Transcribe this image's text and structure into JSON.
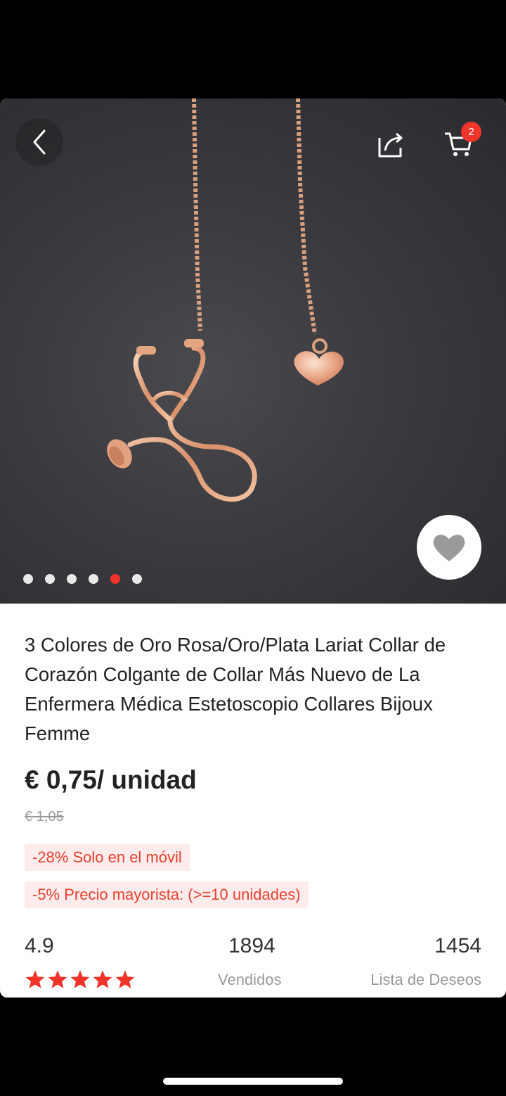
{
  "header": {
    "cart_badge_count": "2",
    "back_icon": "chevron-left-icon",
    "share_icon": "share-icon",
    "cart_icon": "cart-icon",
    "wishlist_icon": "heart-icon"
  },
  "gallery": {
    "image_count": 6,
    "active_index": 4,
    "accent_color": "#f0342a"
  },
  "product": {
    "title": "3 Colores de Oro Rosa/Oro/Plata Lariat Collar de Corazón Colgante de Collar Más Nuevo de La Enfermera Médica Estetoscopio Collares Bijoux Femme",
    "price": "€ 0,75/ unidad",
    "old_price": "€ 1,05",
    "promos": [
      "-28% Solo en el móvil",
      "-5% Precio mayorista: (>=10 unidades)"
    ]
  },
  "stats": {
    "rating": "4.9",
    "stars": 5,
    "sold_count": "1894",
    "sold_label": "Vendidos",
    "wishlist_count": "1454",
    "wishlist_label": "Lista de Deseos"
  },
  "colors": {
    "accent": "#f0342a",
    "promo_bg": "#fdeceb",
    "promo_text": "#e8412f"
  }
}
